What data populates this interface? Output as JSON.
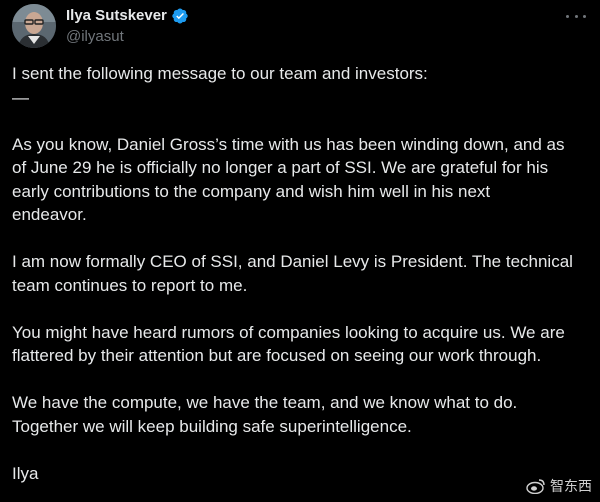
{
  "author": {
    "display_name": "Ilya Sutskever",
    "handle": "@ilyasut",
    "verified": true,
    "accent_color": "#1d9bf0"
  },
  "icons": {
    "avatar": "profile-photo",
    "verified": "verified-badge-icon",
    "more": "more-options-icon",
    "watermark": "weibo-logo-icon"
  },
  "tweet": {
    "line_intro": "I sent the following message to our team and investors:",
    "dash": "—",
    "p1_l1": "As you know, Daniel Gross’s time with us has been winding down, and as",
    "p1_l2": "of June 29 he is officially no longer a part of SSI. We are grateful for his",
    "p1_l3": "early contributions to the company and wish him well in his next",
    "p1_l4": "endeavor.",
    "p2_l1": "I am now formally CEO of SSI, and Daniel Levy is President. The technical",
    "p2_l2": "team continues to report to me.",
    "p3_l1": "You might have heard rumors of companies looking to acquire us. We are",
    "p3_l2": "flattered by their attention but are focused on seeing our work through.",
    "p4_l1": "We have the compute, we have the team, and we know what to do.",
    "p4_l2": "Together we will keep building safe superintelligence.",
    "signoff": "Ilya"
  },
  "watermark": {
    "text": "智东西"
  },
  "colors": {
    "background": "#000000",
    "text": "#e7e9ea",
    "secondary_text": "#71767b"
  }
}
